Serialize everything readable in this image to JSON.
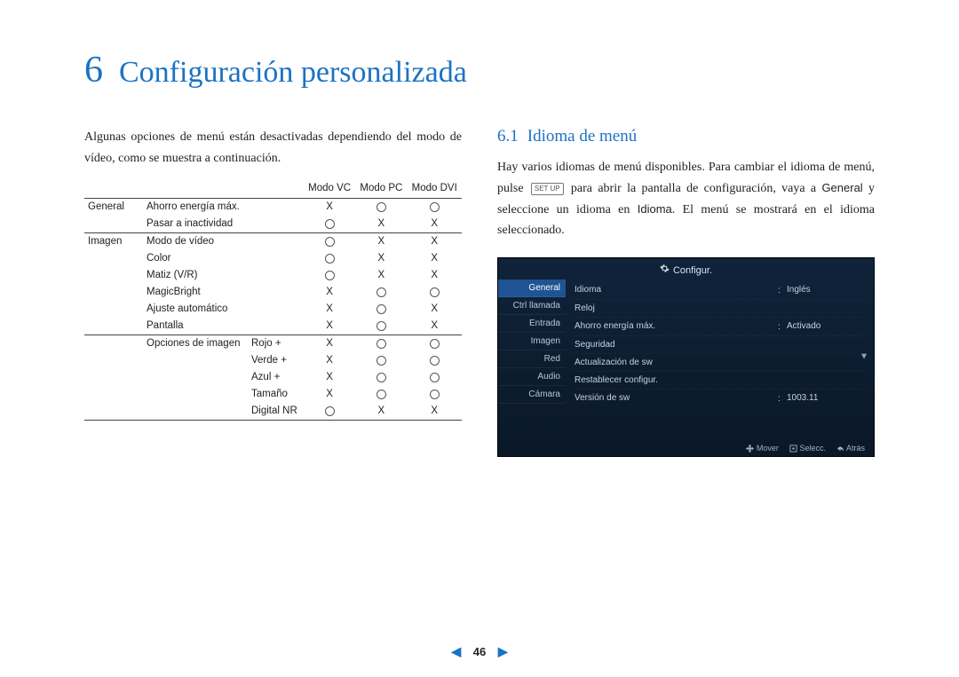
{
  "chapter": {
    "number": "6",
    "title": "Configuración personalizada"
  },
  "left": {
    "intro": "Algunas opciones de menú están desactivadas dependiendo del modo de vídeo, como se muestra a continuación.",
    "table": {
      "head": {
        "c1": "",
        "c2": "",
        "c3": "",
        "c4": "Modo VC",
        "c5": "Modo PC",
        "c6": "Modo DVI"
      },
      "groups": [
        {
          "name": "General",
          "rows": [
            {
              "label": "Ahorro energía máx.",
              "opt": "",
              "vc": "X",
              "pc": "O",
              "dvi": "O"
            },
            {
              "label": "Pasar a inactividad",
              "opt": "",
              "vc": "O",
              "pc": "X",
              "dvi": "X"
            }
          ]
        },
        {
          "name": "Imagen",
          "rows": [
            {
              "label": "Modo de vídeo",
              "opt": "",
              "vc": "O",
              "pc": "X",
              "dvi": "X"
            },
            {
              "label": "Color",
              "opt": "",
              "vc": "O",
              "pc": "X",
              "dvi": "X"
            },
            {
              "label": "Matiz (V/R)",
              "opt": "",
              "vc": "O",
              "pc": "X",
              "dvi": "X"
            },
            {
              "label": "MagicBright",
              "opt": "",
              "vc": "X",
              "pc": "O",
              "dvi": "O"
            },
            {
              "label": "Ajuste automático",
              "opt": "",
              "vc": "X",
              "pc": "O",
              "dvi": "X"
            },
            {
              "label": "Pantalla",
              "opt": "",
              "vc": "X",
              "pc": "O",
              "dvi": "X"
            }
          ]
        },
        {
          "name": "",
          "rows": [
            {
              "label": "Opciones de imagen",
              "opt": "Rojo +",
              "vc": "X",
              "pc": "O",
              "dvi": "O"
            },
            {
              "label": "",
              "opt": "Verde +",
              "vc": "X",
              "pc": "O",
              "dvi": "O"
            },
            {
              "label": "",
              "opt": "Azul +",
              "vc": "X",
              "pc": "O",
              "dvi": "O"
            },
            {
              "label": "",
              "opt": "Tamaño",
              "vc": "X",
              "pc": "O",
              "dvi": "O"
            },
            {
              "label": "",
              "opt": "Digital NR",
              "vc": "O",
              "pc": "X",
              "dvi": "X"
            }
          ]
        }
      ]
    }
  },
  "right": {
    "section_num": "6.1",
    "section_title": "Idioma de menú",
    "para_before_key": "Hay varios idiomas de menú disponibles. Para cambiar el idioma de menú, pulse ",
    "setup_key": "SET UP",
    "para_after_key_before_g": " para abrir la pantalla de configuración, vaya a ",
    "general_word": "General",
    "para_between": " y seleccione un idioma en ",
    "idioma_word": "Idioma",
    "para_end": ". El menú se mostrará en el idioma seleccionado.",
    "osd": {
      "title": "Configur.",
      "side": [
        "General",
        "Ctrl llamada",
        "Entrada",
        "Imagen",
        "Red",
        "Audio",
        "Cámara"
      ],
      "rows": [
        {
          "label": "Idioma",
          "value": "Inglés"
        },
        {
          "label": "Reloj",
          "value": ""
        },
        {
          "label": "Ahorro energía máx.",
          "value": "Activado"
        },
        {
          "label": "Seguridad",
          "value": ""
        },
        {
          "label": "Actualización de sw",
          "value": ""
        },
        {
          "label": "Restablecer configur.",
          "value": ""
        },
        {
          "label": "Versión de sw",
          "value": "1003.11"
        }
      ],
      "foot": {
        "move": "Mover",
        "select": "Selecc.",
        "back": "Atrás"
      }
    }
  },
  "pager": {
    "page": "46"
  }
}
